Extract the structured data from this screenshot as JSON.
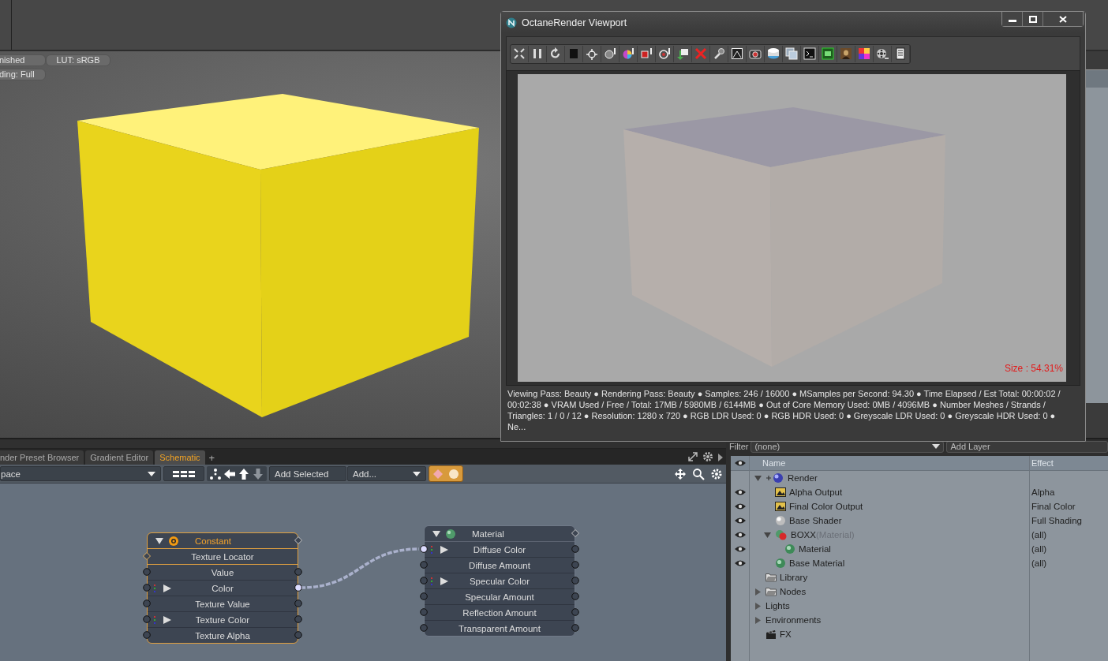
{
  "viewport": {
    "badges": [
      {
        "text": "nished"
      },
      {
        "text": "LUT: sRGB"
      },
      {
        "text": "ding: Full"
      }
    ]
  },
  "octane_window": {
    "title": "OctaneRender Viewport",
    "size_label": "Size : 54.31%",
    "status": "Viewing Pass: Beauty ● Rendering Pass: Beauty ● Samples: 246  / 16000 ● MSamples per Second: 94.30 ● Time Elapsed / Est Total: 00:00:02 / 00:02:38 ● VRAM Used / Free / Total: 17MB / 5980MB / 6144MB ● Out of Core Memory Used: 0MB / 4096MB ● Number Meshes / Strands / Triangles: 1 / 0 / 12 ● Resolution: 1280 x 720 ● RGB LDR Used: 0 ● RGB HDR Used: 0 ● Greyscale LDR Used: 0 ● Greyscale HDR Used: 0 ● Ne..."
  },
  "schematic": {
    "tabs": [
      {
        "label": "nder Preset Browser",
        "selected": false
      },
      {
        "label": "Gradient Editor",
        "selected": false
      },
      {
        "label": "Schematic",
        "selected": true
      }
    ],
    "add_tab": "+",
    "workspace": "pace",
    "add_selected": "Add Selected",
    "add_menu": "Add...",
    "nodes": [
      {
        "title": "Constant",
        "kind": "texture",
        "selected": true,
        "rows": [
          {
            "label": "Texture Locator",
            "kind": "locator"
          },
          {
            "label": "Value",
            "kind": "port",
            "expandable": false,
            "connected": false
          },
          {
            "label": "Color",
            "kind": "port",
            "expandable": true,
            "connected": true
          },
          {
            "label": "Texture Value",
            "kind": "port",
            "expandable": false,
            "connected": false
          },
          {
            "label": "Texture Color",
            "kind": "port",
            "expandable": true,
            "connected": false
          },
          {
            "label": "Texture Alpha",
            "kind": "port",
            "expandable": false,
            "connected": false
          }
        ]
      },
      {
        "title": "Material",
        "kind": "material",
        "selected": false,
        "rows": [
          {
            "label": "Diffuse Color",
            "kind": "port",
            "expandable": true,
            "connected": true
          },
          {
            "label": "Diffuse Amount",
            "kind": "port",
            "expandable": false,
            "connected": false
          },
          {
            "label": "Specular Color",
            "kind": "port",
            "expandable": true,
            "connected": false
          },
          {
            "label": "Specular Amount",
            "kind": "port",
            "expandable": false,
            "connected": false
          },
          {
            "label": "Reflection Amount",
            "kind": "port",
            "expandable": false,
            "connected": false
          },
          {
            "label": "Transparent Amount",
            "kind": "port",
            "expandable": false,
            "connected": false
          }
        ]
      }
    ]
  },
  "shader_tree": {
    "filter_label": "Filter",
    "filter_value": "(none)",
    "add_layer": "Add Layer",
    "columns": [
      "Name",
      "Effect"
    ],
    "rows": [
      {
        "name": "Render",
        "kind": "render",
        "visible": false,
        "expanded": true,
        "children": [
          {
            "name": "Alpha Output",
            "kind": "output",
            "visible": true,
            "effect": "Alpha"
          },
          {
            "name": "Final Color Output",
            "kind": "output",
            "visible": true,
            "effect": "Final Color"
          },
          {
            "name": "Base Shader",
            "kind": "shader",
            "visible": true,
            "effect": "Full Shading"
          },
          {
            "name": "BOXX",
            "type_label": "(Material)",
            "kind": "mask",
            "visible": true,
            "effect": "(all)",
            "expanded": true,
            "children": [
              {
                "name": "Material",
                "kind": "material",
                "visible": true,
                "effect": "(all)"
              }
            ]
          },
          {
            "name": "Base Material",
            "kind": "material",
            "visible": true,
            "effect": "(all)"
          }
        ]
      },
      {
        "name": "Library",
        "kind": "folder",
        "visible": false
      },
      {
        "name": "Nodes",
        "kind": "folder",
        "visible": false,
        "expanded": false
      },
      {
        "name": "Lights",
        "kind": "none",
        "visible": false,
        "expanded": false
      },
      {
        "name": "Environments",
        "kind": "none",
        "visible": false,
        "expanded": false
      },
      {
        "name": "FX",
        "kind": "clapper",
        "visible": false
      }
    ]
  }
}
